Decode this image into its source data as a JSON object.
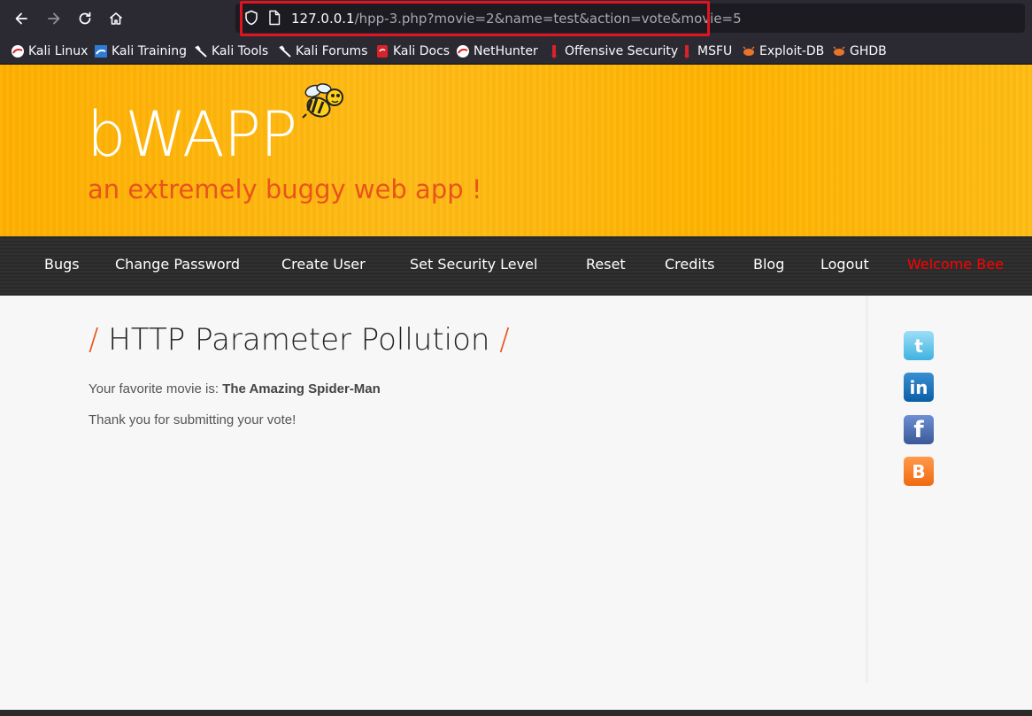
{
  "browser": {
    "url_host": "127.0.0.1",
    "url_path": "/hpp-3.php?movie=2&name=test&action=vote&movie=5",
    "bookmarks": [
      {
        "label": "Kali Linux",
        "icon": "kali-icon"
      },
      {
        "label": "Kali Training",
        "icon": "kali-training-icon"
      },
      {
        "label": "Kali Tools",
        "icon": "kali-tools-icon"
      },
      {
        "label": "Kali Forums",
        "icon": "kali-forums-icon"
      },
      {
        "label": "Kali Docs",
        "icon": "kali-docs-icon"
      },
      {
        "label": "NetHunter",
        "icon": "nethunter-icon"
      },
      {
        "label": "Offensive Security",
        "icon": "offsec-icon"
      },
      {
        "label": "MSFU",
        "icon": "msfu-icon"
      },
      {
        "label": "Exploit-DB",
        "icon": "exploitdb-icon"
      },
      {
        "label": "GHDB",
        "icon": "ghdb-icon"
      }
    ]
  },
  "header": {
    "logo": "bWAPP",
    "tagline": "an extremely buggy web app !"
  },
  "menu": {
    "items": [
      "Bugs",
      "Change Password",
      "Create User",
      "Set Security Level",
      "Reset",
      "Credits",
      "Blog",
      "Logout"
    ],
    "welcome": "Welcome Bee"
  },
  "main": {
    "slash": "/",
    "title": "HTTP Parameter Pollution",
    "favorite_label": "Your favorite movie is: ",
    "favorite_movie": "The Amazing Spider-Man",
    "thanks": "Thank you for submitting your vote!"
  },
  "social": {
    "twitter_glyph": "t",
    "linkedin_glyph": "in",
    "facebook_glyph": "f",
    "blogger_glyph": "B"
  },
  "colors": {
    "header_yellow": "#ffb70b",
    "accent_orange": "#e8541c",
    "welcome_red": "#ff0000",
    "url_highlight": "#e0141e"
  }
}
